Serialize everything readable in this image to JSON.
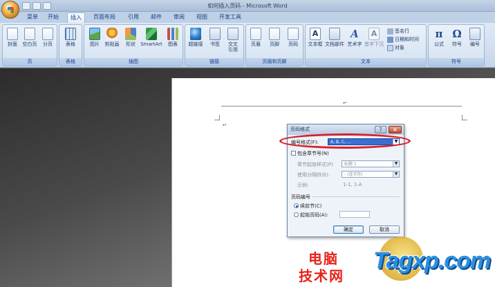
{
  "window": {
    "title": "如何插入页码 - Microsoft Word"
  },
  "tabs": [
    {
      "label": "菜单"
    },
    {
      "label": "开始"
    },
    {
      "label": "插入"
    },
    {
      "label": "页面布局"
    },
    {
      "label": "引用"
    },
    {
      "label": "邮件"
    },
    {
      "label": "审阅"
    },
    {
      "label": "视图"
    },
    {
      "label": "开发工具"
    }
  ],
  "ribbon": {
    "groups": [
      {
        "label": "页"
      },
      {
        "label": "表格"
      },
      {
        "label": "插图"
      },
      {
        "label": "链接"
      },
      {
        "label": "页眉和页脚"
      },
      {
        "label": "文本"
      },
      {
        "label": "符号"
      }
    ],
    "buttons": {
      "cover": "封面",
      "blank": "空白页",
      "pagebreak": "分页",
      "table": "表格",
      "picture": "图片",
      "clipart": "剪贴画",
      "shapes": "形状",
      "smartart": "SmartArt",
      "chart": "图表",
      "hyperlink": "超链接",
      "bookmark": "书签",
      "crossref": "交叉引用",
      "header": "页眉",
      "footer": "页脚",
      "pagenum": "页码",
      "textbox": "文本框",
      "quickparts": "文档部件",
      "wordart": "艺术字",
      "dropcap": "首字下沉",
      "signature": "签名行",
      "datetime": "日期和时间",
      "object": "对象",
      "equation": "公式",
      "symbol": "符号",
      "number": "编号",
      "equation_glyph": "π",
      "symbol_glyph": "Ω"
    }
  },
  "document": {
    "return_mark": "↵"
  },
  "dialog": {
    "title": "页码格式",
    "help": "?",
    "close": "×",
    "number_format_label": "编号格式(F):",
    "number_format_value": "A, B, C, …",
    "include_chapter_label": "包含章节号(N)",
    "chapter_style_label": "章节起始样式(P)",
    "chapter_style_value": "标题 1",
    "separator_label": "使用分隔符(E):",
    "separator_value": "-  (连字符)",
    "example_label": "示例:",
    "example_value": "1-1, 1-A",
    "section_title": "页码编号",
    "continue_label": "续前节(C)",
    "start_at_label": "起始页码(A):",
    "ok": "确定",
    "cancel": "取消"
  },
  "watermark": {
    "line1": "电脑",
    "line2": "技术网",
    "logo": "Tagxp.com"
  }
}
